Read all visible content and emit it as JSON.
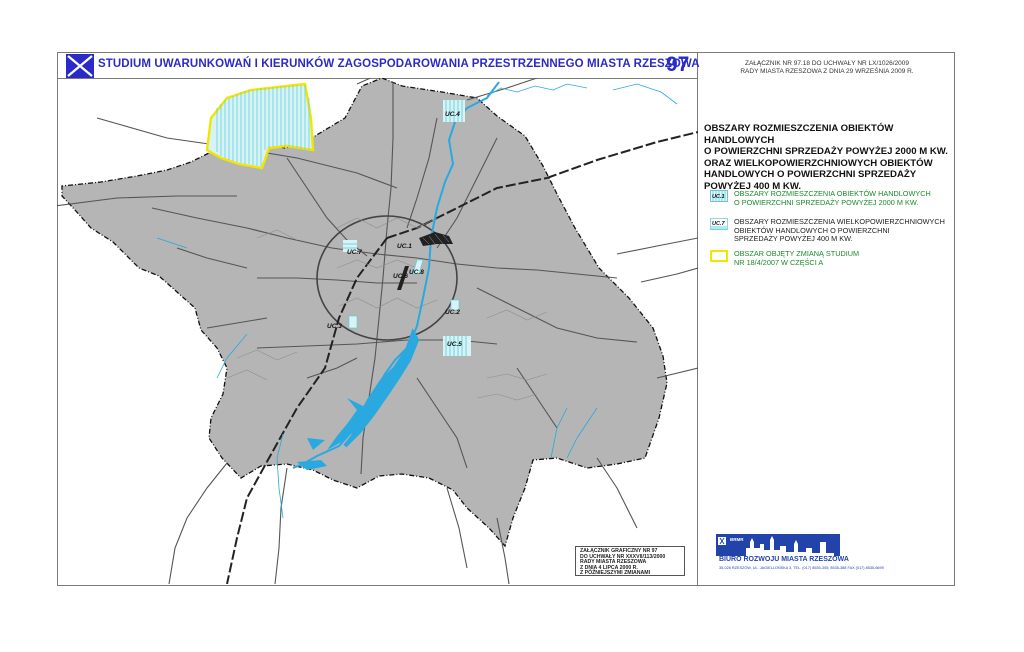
{
  "header": {
    "title": "STUDIUM UWARUNKOWAŃ I KIERUNKÓW ZAGOSPODAROWANIA PRZESTRZENNEGO MIASTA RZESZOWA",
    "number": "97"
  },
  "attachment": {
    "line1": "ZAŁĄCZNIK NR 97.18 DO UCHWAŁY NR LX/1026/2009",
    "line2": "RADY MIASTA RZESZOWA Z DNIA 29 WRZEŚNIA 2009 R."
  },
  "legend": {
    "heading_l1": "OBSZARY ROZMIESZCZENIA OBIEKTÓW HANDLOWYCH",
    "heading_l2": "O POWIERZCHNI SPRZEDAŻY POWYŻEJ 2000 M KW.",
    "heading_l3": "ORAZ WIELKOPOWIERZCHNIOWYCH OBIEKTÓW",
    "heading_l4": "HANDLOWYCH O POWIERZCHNI SPRZEDAŻY",
    "heading_l5": "POWYŻEJ 400 M KW.",
    "items": [
      {
        "code": "UC.1",
        "line1": "OBSZARY ROZMIESZCZENIA OBIEKTÓW HANDLOWYCH",
        "line2": "O POWIERZCHNI SPRZEDAŻY POWYŻEJ 2000 M KW.",
        "line3": "",
        "color": "#1a8a2a"
      },
      {
        "code": "UC.7",
        "line1": "OBSZARY ROZMIESZCZENIA WIELKOPOWIERZCHNIOWYCH",
        "line2": "OBIEKTÓW HANDLOWYCH O POWIERZCHNI",
        "line3": "SPRZEDAŻY POWYŻEJ 400 M KW.",
        "color": "#222222"
      },
      {
        "code": "",
        "line1": "OBSZAR OBJĘTY ZMIANĄ STUDIUM",
        "line2": "NR 18/4/2007 W CZĘŚCI A",
        "line3": "",
        "color": "#1a8a2a"
      }
    ]
  },
  "stamp": {
    "l1": "ZAŁĄCZNIK GRAFICZNY NR 97",
    "l2": "DO UCHWAŁY  NR XXXVII/113/2000",
    "l3": "RADY MIASTA RZESZOWA",
    "l4": "Z DNIA  4  LIPCA 2000 R.",
    "l5": "Z PÓŹNIEJSZYMI ZMIANAMI"
  },
  "bureau": {
    "logo_letters": "BRMR",
    "name": "BIURO ROZWOJU MIASTA RZESZOWA",
    "address": "35-026 RZESZÓW, UL. JAGIELLOŃSKA 3, TEL. (017) 8535-305; 8535-388 FAX (017) 8535-6699"
  },
  "map_labels": {
    "uc1": "UC.1",
    "uc2": "UC.2",
    "uc3": "UC.3",
    "uc4": "UC.4",
    "uc5": "UC.5",
    "uc6": "UC.6",
    "uc7": "UC.7",
    "uc8": "UC.8"
  },
  "colors": {
    "accent_blue": "#2a2ac8",
    "city_fill": "#b5b5b5",
    "water": "#29a9e0",
    "change_area": "#f2e600",
    "legend_green": "#1a8a2a",
    "hatch_cyan": "#4fd0e0"
  }
}
